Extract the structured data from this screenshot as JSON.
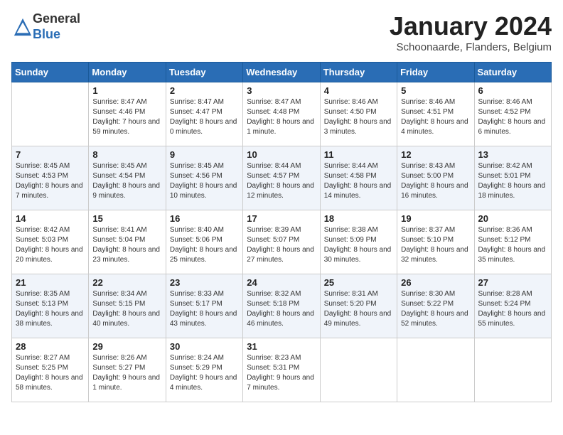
{
  "header": {
    "logo": {
      "line1": "General",
      "line2": "Blue"
    },
    "title": "January 2024",
    "location": "Schoonaarde, Flanders, Belgium"
  },
  "days_of_week": [
    "Sunday",
    "Monday",
    "Tuesday",
    "Wednesday",
    "Thursday",
    "Friday",
    "Saturday"
  ],
  "weeks": [
    [
      {
        "num": "",
        "sunrise": "",
        "sunset": "",
        "daylight": ""
      },
      {
        "num": "1",
        "sunrise": "Sunrise: 8:47 AM",
        "sunset": "Sunset: 4:46 PM",
        "daylight": "Daylight: 7 hours and 59 minutes."
      },
      {
        "num": "2",
        "sunrise": "Sunrise: 8:47 AM",
        "sunset": "Sunset: 4:47 PM",
        "daylight": "Daylight: 8 hours and 0 minutes."
      },
      {
        "num": "3",
        "sunrise": "Sunrise: 8:47 AM",
        "sunset": "Sunset: 4:48 PM",
        "daylight": "Daylight: 8 hours and 1 minute."
      },
      {
        "num": "4",
        "sunrise": "Sunrise: 8:46 AM",
        "sunset": "Sunset: 4:50 PM",
        "daylight": "Daylight: 8 hours and 3 minutes."
      },
      {
        "num": "5",
        "sunrise": "Sunrise: 8:46 AM",
        "sunset": "Sunset: 4:51 PM",
        "daylight": "Daylight: 8 hours and 4 minutes."
      },
      {
        "num": "6",
        "sunrise": "Sunrise: 8:46 AM",
        "sunset": "Sunset: 4:52 PM",
        "daylight": "Daylight: 8 hours and 6 minutes."
      }
    ],
    [
      {
        "num": "7",
        "sunrise": "Sunrise: 8:45 AM",
        "sunset": "Sunset: 4:53 PM",
        "daylight": "Daylight: 8 hours and 7 minutes."
      },
      {
        "num": "8",
        "sunrise": "Sunrise: 8:45 AM",
        "sunset": "Sunset: 4:54 PM",
        "daylight": "Daylight: 8 hours and 9 minutes."
      },
      {
        "num": "9",
        "sunrise": "Sunrise: 8:45 AM",
        "sunset": "Sunset: 4:56 PM",
        "daylight": "Daylight: 8 hours and 10 minutes."
      },
      {
        "num": "10",
        "sunrise": "Sunrise: 8:44 AM",
        "sunset": "Sunset: 4:57 PM",
        "daylight": "Daylight: 8 hours and 12 minutes."
      },
      {
        "num": "11",
        "sunrise": "Sunrise: 8:44 AM",
        "sunset": "Sunset: 4:58 PM",
        "daylight": "Daylight: 8 hours and 14 minutes."
      },
      {
        "num": "12",
        "sunrise": "Sunrise: 8:43 AM",
        "sunset": "Sunset: 5:00 PM",
        "daylight": "Daylight: 8 hours and 16 minutes."
      },
      {
        "num": "13",
        "sunrise": "Sunrise: 8:42 AM",
        "sunset": "Sunset: 5:01 PM",
        "daylight": "Daylight: 8 hours and 18 minutes."
      }
    ],
    [
      {
        "num": "14",
        "sunrise": "Sunrise: 8:42 AM",
        "sunset": "Sunset: 5:03 PM",
        "daylight": "Daylight: 8 hours and 20 minutes."
      },
      {
        "num": "15",
        "sunrise": "Sunrise: 8:41 AM",
        "sunset": "Sunset: 5:04 PM",
        "daylight": "Daylight: 8 hours and 23 minutes."
      },
      {
        "num": "16",
        "sunrise": "Sunrise: 8:40 AM",
        "sunset": "Sunset: 5:06 PM",
        "daylight": "Daylight: 8 hours and 25 minutes."
      },
      {
        "num": "17",
        "sunrise": "Sunrise: 8:39 AM",
        "sunset": "Sunset: 5:07 PM",
        "daylight": "Daylight: 8 hours and 27 minutes."
      },
      {
        "num": "18",
        "sunrise": "Sunrise: 8:38 AM",
        "sunset": "Sunset: 5:09 PM",
        "daylight": "Daylight: 8 hours and 30 minutes."
      },
      {
        "num": "19",
        "sunrise": "Sunrise: 8:37 AM",
        "sunset": "Sunset: 5:10 PM",
        "daylight": "Daylight: 8 hours and 32 minutes."
      },
      {
        "num": "20",
        "sunrise": "Sunrise: 8:36 AM",
        "sunset": "Sunset: 5:12 PM",
        "daylight": "Daylight: 8 hours and 35 minutes."
      }
    ],
    [
      {
        "num": "21",
        "sunrise": "Sunrise: 8:35 AM",
        "sunset": "Sunset: 5:13 PM",
        "daylight": "Daylight: 8 hours and 38 minutes."
      },
      {
        "num": "22",
        "sunrise": "Sunrise: 8:34 AM",
        "sunset": "Sunset: 5:15 PM",
        "daylight": "Daylight: 8 hours and 40 minutes."
      },
      {
        "num": "23",
        "sunrise": "Sunrise: 8:33 AM",
        "sunset": "Sunset: 5:17 PM",
        "daylight": "Daylight: 8 hours and 43 minutes."
      },
      {
        "num": "24",
        "sunrise": "Sunrise: 8:32 AM",
        "sunset": "Sunset: 5:18 PM",
        "daylight": "Daylight: 8 hours and 46 minutes."
      },
      {
        "num": "25",
        "sunrise": "Sunrise: 8:31 AM",
        "sunset": "Sunset: 5:20 PM",
        "daylight": "Daylight: 8 hours and 49 minutes."
      },
      {
        "num": "26",
        "sunrise": "Sunrise: 8:30 AM",
        "sunset": "Sunset: 5:22 PM",
        "daylight": "Daylight: 8 hours and 52 minutes."
      },
      {
        "num": "27",
        "sunrise": "Sunrise: 8:28 AM",
        "sunset": "Sunset: 5:24 PM",
        "daylight": "Daylight: 8 hours and 55 minutes."
      }
    ],
    [
      {
        "num": "28",
        "sunrise": "Sunrise: 8:27 AM",
        "sunset": "Sunset: 5:25 PM",
        "daylight": "Daylight: 8 hours and 58 minutes."
      },
      {
        "num": "29",
        "sunrise": "Sunrise: 8:26 AM",
        "sunset": "Sunset: 5:27 PM",
        "daylight": "Daylight: 9 hours and 1 minute."
      },
      {
        "num": "30",
        "sunrise": "Sunrise: 8:24 AM",
        "sunset": "Sunset: 5:29 PM",
        "daylight": "Daylight: 9 hours and 4 minutes."
      },
      {
        "num": "31",
        "sunrise": "Sunrise: 8:23 AM",
        "sunset": "Sunset: 5:31 PM",
        "daylight": "Daylight: 9 hours and 7 minutes."
      },
      {
        "num": "",
        "sunrise": "",
        "sunset": "",
        "daylight": ""
      },
      {
        "num": "",
        "sunrise": "",
        "sunset": "",
        "daylight": ""
      },
      {
        "num": "",
        "sunrise": "",
        "sunset": "",
        "daylight": ""
      }
    ]
  ]
}
